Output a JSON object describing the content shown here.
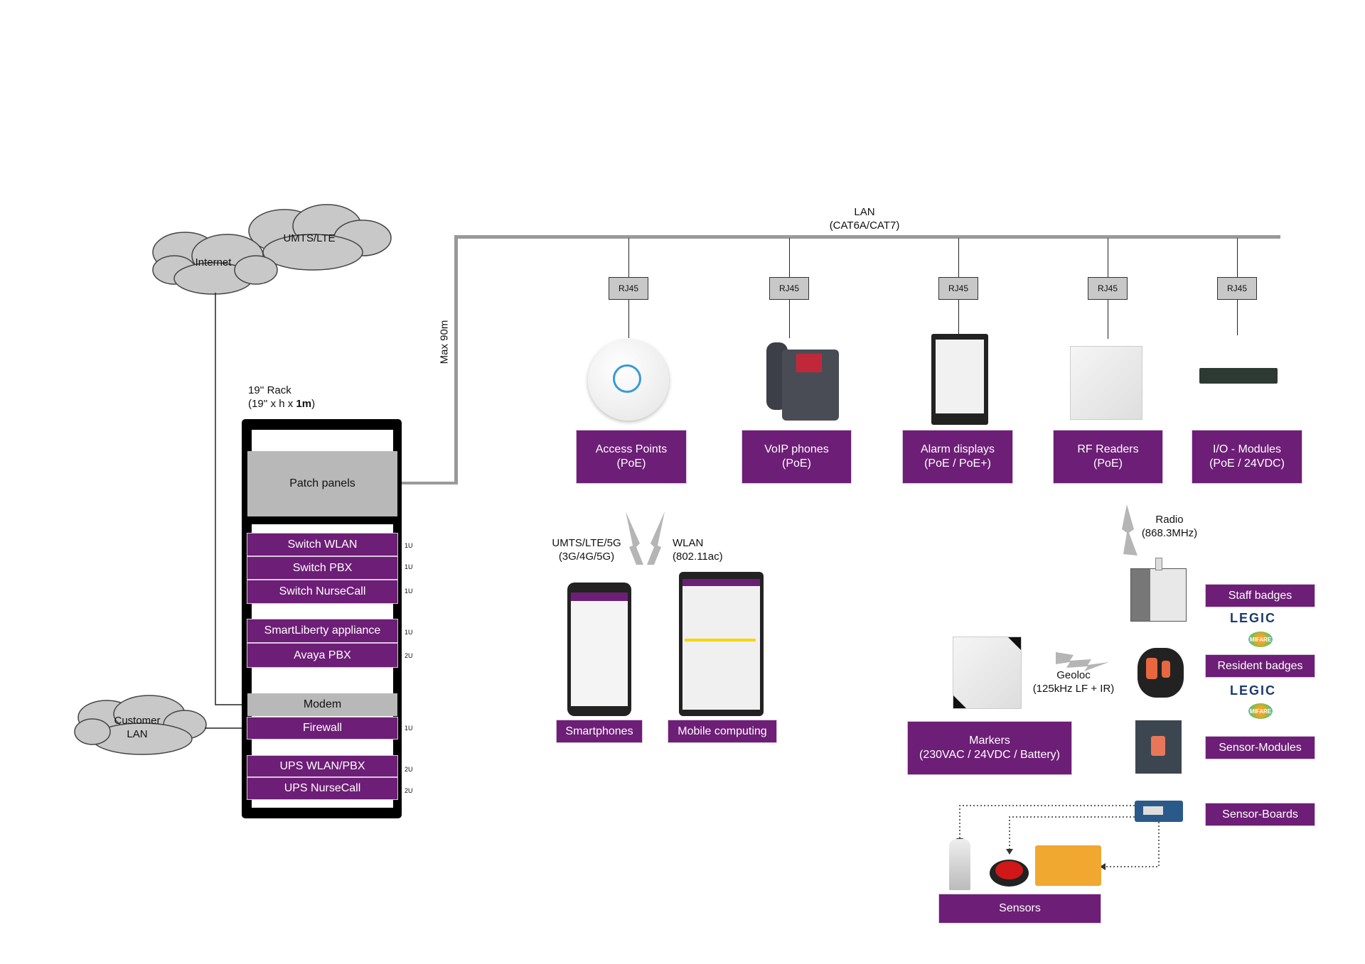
{
  "colors": {
    "accent": "#6d1e76",
    "cable": "#999999",
    "panel": "#b8b8b8"
  },
  "lan": {
    "label": "LAN\n(CAT6A/CAT7)",
    "max_length": "Max 90m"
  },
  "clouds": {
    "internet": "Internet",
    "umts": "UMTS/LTE",
    "customer_lan": "Customer\nLAN"
  },
  "rack": {
    "title": "19'' Rack",
    "dims_prefix": "(19'' x h x ",
    "dims_bold": "1m",
    "dims_suffix": ")",
    "patch": "Patch panels",
    "units": [
      {
        "label": "Switch WLAN",
        "u": "1U"
      },
      {
        "label": "Switch PBX",
        "u": "1U"
      },
      {
        "label": "Switch NurseCall",
        "u": "1U"
      },
      {
        "label": "SmartLiberty appliance",
        "u": "1U"
      },
      {
        "label": "Avaya PBX",
        "u": "2U"
      },
      {
        "label": "Modem",
        "u": ""
      },
      {
        "label": "Firewall",
        "u": "1U"
      },
      {
        "label": "UPS WLAN/PBX",
        "u": "2U"
      },
      {
        "label": "UPS NurseCall",
        "u": "2U"
      }
    ]
  },
  "rj45": "RJ45",
  "devices": [
    "Access Points\n(PoE)",
    "VoIP phones\n(PoE)",
    "Alarm displays\n(PoE / PoE+)",
    "RF Readers\n(PoE)",
    "I/O - Modules\n(PoE / 24VDC)"
  ],
  "wireless": {
    "cellular": "UMTS/LTE/5G\n(3G/4G/5G)",
    "wlan": "WLAN\n(802.11ac)",
    "radio": "Radio\n(868.3MHz)",
    "geoloc": "Geoloc\n(125kHz LF + IR)"
  },
  "mobile": {
    "smartphones": "Smartphones",
    "mobile_computing": "Mobile computing"
  },
  "badges": {
    "staff": "Staff badges",
    "resident": "Resident badges",
    "sensor_modules": "Sensor-Modules",
    "sensor_boards": "Sensor-Boards",
    "legic": "LEGIC",
    "mifare": "MIFARE"
  },
  "markers": "Markers\n(230VAC / 24VDC / Battery)",
  "sensors": "Sensors"
}
